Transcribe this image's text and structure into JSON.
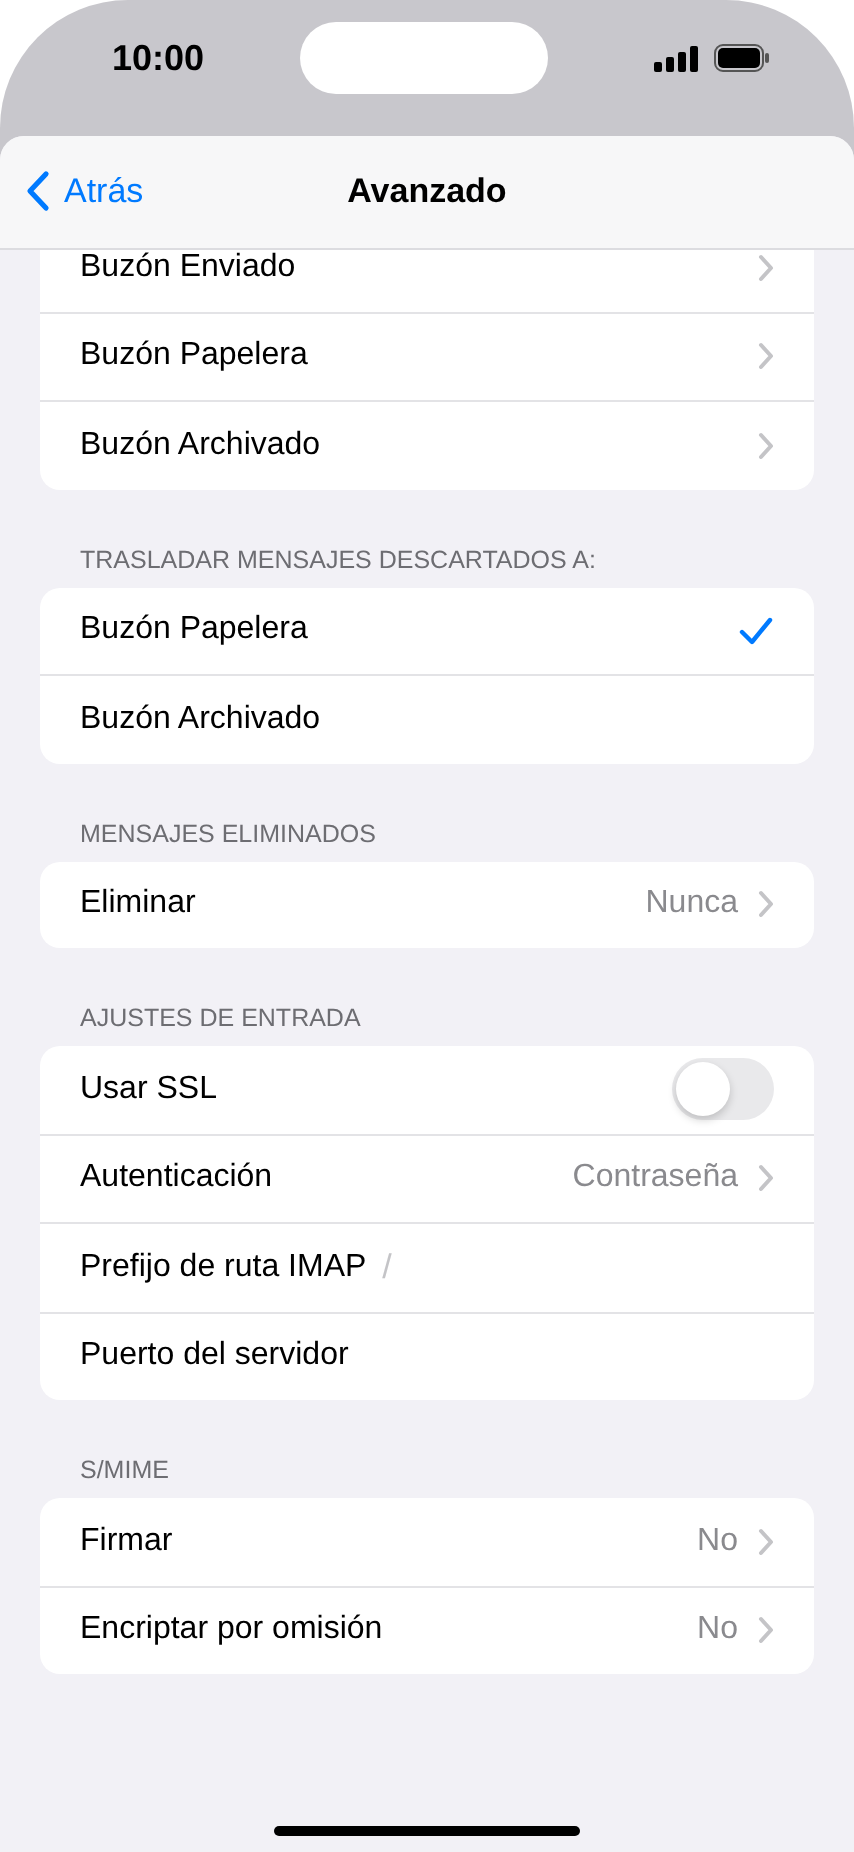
{
  "status_bar": {
    "time": "10:00"
  },
  "nav": {
    "back": "Atrás",
    "title": "Avanzado"
  },
  "sections": [
    {
      "rows": [
        {
          "kind": "link",
          "label": "Buzón Enviado"
        },
        {
          "kind": "link",
          "label": "Buzón Papelera"
        },
        {
          "kind": "link",
          "label": "Buzón Archivado"
        }
      ]
    },
    {
      "header": "TRASLADAR MENSAJES DESCARTADOS A:",
      "rows": [
        {
          "kind": "check",
          "label": "Buzón Papelera",
          "selected": true
        },
        {
          "kind": "check",
          "label": "Buzón Archivado",
          "selected": false
        }
      ]
    },
    {
      "header": "MENSAJES ELIMINADOS",
      "rows": [
        {
          "kind": "link",
          "label": "Eliminar",
          "value": "Nunca"
        }
      ]
    },
    {
      "header": "AJUSTES DE ENTRADA",
      "rows": [
        {
          "kind": "toggle",
          "label": "Usar SSL",
          "on": false
        },
        {
          "kind": "link",
          "label": "Autenticación",
          "value": "Contraseña"
        },
        {
          "kind": "field",
          "label": "Prefijo de ruta IMAP",
          "placeholder": "/"
        },
        {
          "kind": "field",
          "label": "Puerto del servidor"
        }
      ]
    },
    {
      "header": "S/MIME",
      "rows": [
        {
          "kind": "link",
          "label": "Firmar",
          "value": "No"
        },
        {
          "kind": "link",
          "label": "Encriptar por omisión",
          "value": "No"
        }
      ]
    }
  ]
}
